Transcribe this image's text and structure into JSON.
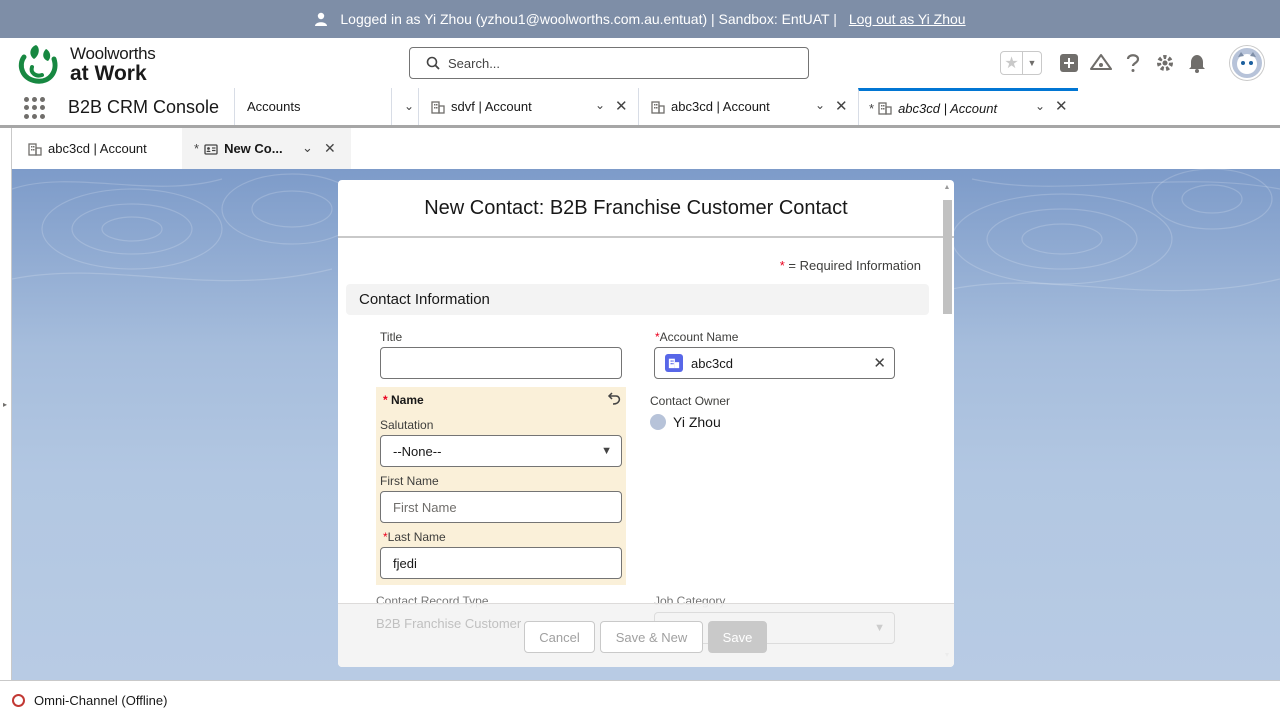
{
  "banner": {
    "logged_in_text": "Logged in as Yi Zhou (yzhou1@woolworths.com.au.entuat) | Sandbox: EntUAT |",
    "logout_link": "Log out as Yi Zhou"
  },
  "logo": {
    "line1": "Woolworths",
    "line2": "at Work"
  },
  "search": {
    "placeholder": "Search..."
  },
  "app": {
    "name": "B2B CRM Console"
  },
  "nav_tabs": [
    {
      "label": "Accounts"
    },
    {
      "label": "sdvf | Account"
    },
    {
      "label": "abc3cd | Account"
    },
    {
      "label": "abc3cd | Account",
      "dirty": "*"
    }
  ],
  "subtabs": [
    {
      "label": "abc3cd | Account"
    },
    {
      "label": "New Co...",
      "dirty": "*"
    }
  ],
  "modal": {
    "title": "New Contact: B2B Franchise Customer Contact",
    "required_note": "= Required Information",
    "required_star": "*",
    "section_title": "Contact Information",
    "fields": {
      "title_label": "Title",
      "title_value": "",
      "account_label": "Account Name",
      "account_value": "abc3cd",
      "name_group": "Name",
      "salutation_label": "Salutation",
      "salutation_value": "--None--",
      "first_name_label": "First Name",
      "first_name_placeholder": "First Name",
      "last_name_label": "Last Name",
      "last_name_value": "fjedi",
      "owner_label": "Contact Owner",
      "owner_value": "Yi Zhou",
      "record_type_label": "Contact Record Type",
      "record_type_value": "B2B Franchise Customer",
      "job_category_label": "Job Category"
    },
    "buttons": {
      "cancel": "Cancel",
      "save_new": "Save & New",
      "save": "Save"
    }
  },
  "utility": {
    "omni_channel": "Omni-Channel (Offline)"
  },
  "colors": {
    "banner": "#7e8ea7",
    "brand_green": "#178841",
    "active_tab": "#0176d3",
    "required": "#ea001e"
  }
}
